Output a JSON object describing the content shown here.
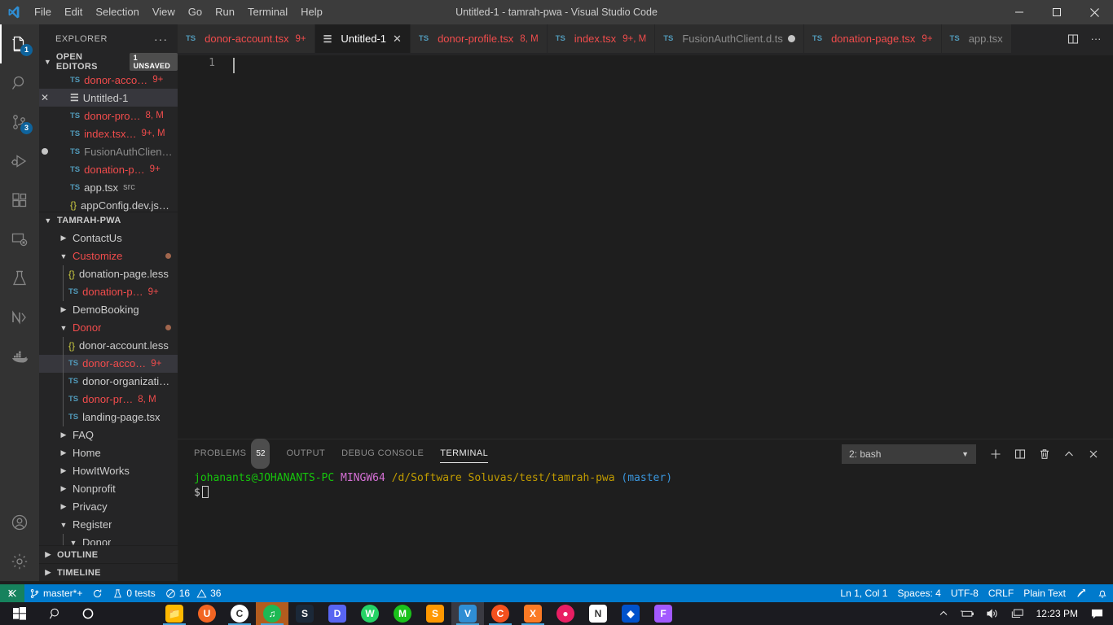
{
  "window": {
    "title": "Untitled-1 - tamrah-pwa - Visual Studio Code",
    "minimize_label": "–",
    "maximize_label": "❐",
    "close_label": "✕"
  },
  "menubar": {
    "items": [
      {
        "label": "File"
      },
      {
        "label": "Edit"
      },
      {
        "label": "Selection"
      },
      {
        "label": "View"
      },
      {
        "label": "Go"
      },
      {
        "label": "Run"
      },
      {
        "label": "Terminal"
      },
      {
        "label": "Help"
      }
    ]
  },
  "activitybar": {
    "items": [
      {
        "name": "explorer",
        "icon": "files-icon",
        "badge": "1",
        "active": true
      },
      {
        "name": "search",
        "icon": "search-icon",
        "badge": "",
        "active": false
      },
      {
        "name": "source-control",
        "icon": "source-control-icon",
        "badge": "3",
        "active": false
      },
      {
        "name": "run-debug",
        "icon": "run-and-debug-icon",
        "badge": "",
        "active": false
      },
      {
        "name": "extensions",
        "icon": "extensions-icon",
        "badge": "",
        "active": false
      },
      {
        "name": "remote-explorer",
        "icon": "remote-explorer-icon",
        "badge": "",
        "active": false
      },
      {
        "name": "testing",
        "icon": "beaker-icon",
        "badge": "",
        "active": false
      },
      {
        "name": "nx-console",
        "icon": "nx-icon",
        "badge": "",
        "active": false
      },
      {
        "name": "docker",
        "icon": "docker-icon",
        "badge": "",
        "active": false
      }
    ],
    "bottom": [
      {
        "name": "accounts",
        "icon": "account-icon"
      },
      {
        "name": "settings",
        "icon": "gear-icon"
      }
    ]
  },
  "sidebar": {
    "title": "EXPLORER",
    "more_actions": "···",
    "open_editors": {
      "label": "OPEN EDITORS",
      "badge": "1 UNSAVED",
      "expanded": true,
      "items": [
        {
          "icon": "ts",
          "name": "donor-acco…",
          "suffix": "9+",
          "suffix_class": "c-err",
          "name_class": "c-err",
          "selected": false,
          "dirty": false,
          "showClose": false
        },
        {
          "icon": "untitled",
          "name": "Untitled-1",
          "suffix": "",
          "suffix_class": "",
          "name_class": "c-plain",
          "selected": true,
          "dirty": false,
          "showClose": true
        },
        {
          "icon": "ts",
          "name": "donor-pro…",
          "suffix": "8, M",
          "suffix_class": "c-err",
          "name_class": "c-err",
          "selected": false,
          "dirty": false,
          "showClose": false
        },
        {
          "icon": "ts",
          "name": "index.tsx…",
          "suffix": "9+, M",
          "suffix_class": "c-err",
          "name_class": "c-err",
          "selected": false,
          "dirty": false,
          "showClose": false
        },
        {
          "icon": "ts",
          "name": "FusionAuthClient….",
          "suffix": "",
          "suffix_class": "",
          "name_class": "c-dim",
          "selected": false,
          "dirty": true,
          "showClose": false
        },
        {
          "icon": "ts",
          "name": "donation-p…",
          "suffix": "9+",
          "suffix_class": "c-err",
          "name_class": "c-err",
          "selected": false,
          "dirty": false,
          "showClose": false
        },
        {
          "icon": "ts",
          "name": "app.tsx",
          "suffix": "src",
          "suffix_class": "c-sub",
          "name_class": "c-plain",
          "selected": false,
          "dirty": false,
          "showClose": false
        },
        {
          "icon": "json",
          "name": "appConfig.dev.jso…",
          "suffix": "",
          "suffix_class": "",
          "name_class": "c-plain",
          "selected": false,
          "dirty": false,
          "showClose": false
        }
      ]
    },
    "workspace": {
      "label": "TAMRAH-PWA",
      "expanded": true,
      "items": [
        {
          "kind": "folder",
          "twisty": "›",
          "name": "ContactUs",
          "indent": 24,
          "name_class": "c-plain",
          "suffix": "",
          "suffix_class": "",
          "selected": false,
          "mod": false
        },
        {
          "kind": "folder",
          "twisty": "⌄",
          "name": "Customize",
          "indent": 24,
          "name_class": "c-err",
          "suffix": "",
          "suffix_class": "",
          "selected": false,
          "mod": true
        },
        {
          "kind": "json",
          "twisty": "",
          "name": "donation-page.less",
          "indent": 36,
          "name_class": "c-plain",
          "suffix": "",
          "suffix_class": "",
          "selected": false,
          "mod": false
        },
        {
          "kind": "ts",
          "twisty": "",
          "name": "donation-p…",
          "indent": 36,
          "name_class": "c-err",
          "suffix": "9+",
          "suffix_class": "c-err",
          "selected": false,
          "mod": false
        },
        {
          "kind": "folder",
          "twisty": "›",
          "name": "DemoBooking",
          "indent": 24,
          "name_class": "c-plain",
          "suffix": "",
          "suffix_class": "",
          "selected": false,
          "mod": false
        },
        {
          "kind": "folder",
          "twisty": "⌄",
          "name": "Donor",
          "indent": 24,
          "name_class": "c-err",
          "suffix": "",
          "suffix_class": "",
          "selected": false,
          "mod": true
        },
        {
          "kind": "json",
          "twisty": "",
          "name": "donor-account.less",
          "indent": 36,
          "name_class": "c-plain",
          "suffix": "",
          "suffix_class": "",
          "selected": false,
          "mod": false
        },
        {
          "kind": "ts",
          "twisty": "",
          "name": "donor-acco…",
          "indent": 36,
          "name_class": "c-err",
          "suffix": "9+",
          "suffix_class": "c-err",
          "selected": true,
          "mod": false
        },
        {
          "kind": "ts",
          "twisty": "",
          "name": "donor-organizati…",
          "indent": 36,
          "name_class": "c-plain",
          "suffix": "",
          "suffix_class": "",
          "selected": false,
          "mod": false
        },
        {
          "kind": "ts",
          "twisty": "",
          "name": "donor-pr…",
          "indent": 36,
          "name_class": "c-err",
          "suffix": "8, M",
          "suffix_class": "c-err",
          "selected": false,
          "mod": false
        },
        {
          "kind": "ts",
          "twisty": "",
          "name": "landing-page.tsx",
          "indent": 36,
          "name_class": "c-plain",
          "suffix": "",
          "suffix_class": "",
          "selected": false,
          "mod": false
        },
        {
          "kind": "folder",
          "twisty": "›",
          "name": "FAQ",
          "indent": 24,
          "name_class": "c-plain",
          "suffix": "",
          "suffix_class": "",
          "selected": false,
          "mod": false
        },
        {
          "kind": "folder",
          "twisty": "›",
          "name": "Home",
          "indent": 24,
          "name_class": "c-plain",
          "suffix": "",
          "suffix_class": "",
          "selected": false,
          "mod": false
        },
        {
          "kind": "folder",
          "twisty": "›",
          "name": "HowItWorks",
          "indent": 24,
          "name_class": "c-plain",
          "suffix": "",
          "suffix_class": "",
          "selected": false,
          "mod": false
        },
        {
          "kind": "folder",
          "twisty": "›",
          "name": "Nonprofit",
          "indent": 24,
          "name_class": "c-plain",
          "suffix": "",
          "suffix_class": "",
          "selected": false,
          "mod": false
        },
        {
          "kind": "folder",
          "twisty": "›",
          "name": "Privacy",
          "indent": 24,
          "name_class": "c-plain",
          "suffix": "",
          "suffix_class": "",
          "selected": false,
          "mod": false
        },
        {
          "kind": "folder",
          "twisty": "⌄",
          "name": "Register",
          "indent": 24,
          "name_class": "c-plain",
          "suffix": "",
          "suffix_class": "",
          "selected": false,
          "mod": false
        },
        {
          "kind": "folder",
          "twisty": "⌄",
          "name": "Donor",
          "indent": 36,
          "name_class": "c-plain",
          "suffix": "",
          "suffix_class": "",
          "selected": false,
          "mod": false
        }
      ]
    },
    "outline": {
      "label": "OUTLINE",
      "expanded": false
    },
    "timeline": {
      "label": "TIMELINE",
      "expanded": false
    }
  },
  "tabs": [
    {
      "icon": "ts",
      "label": "donor-account.tsx",
      "suffix": "9+",
      "active": false,
      "dirty": false,
      "close": false,
      "label_class": "c-err"
    },
    {
      "icon": "untitled",
      "label": "Untitled-1",
      "suffix": "",
      "active": true,
      "dirty": false,
      "close": true,
      "label_class": "c-plain"
    },
    {
      "icon": "ts",
      "label": "donor-profile.tsx",
      "suffix": "8, M",
      "active": false,
      "dirty": false,
      "close": false,
      "label_class": "c-err"
    },
    {
      "icon": "ts",
      "label": "index.tsx",
      "suffix": "9+, M",
      "active": false,
      "dirty": false,
      "close": false,
      "label_class": "c-err"
    },
    {
      "icon": "ts",
      "label": "FusionAuthClient.d.ts",
      "suffix": "",
      "active": false,
      "dirty": true,
      "close": false,
      "label_class": "c-dim"
    },
    {
      "icon": "ts",
      "label": "donation-page.tsx",
      "suffix": "9+",
      "active": false,
      "dirty": false,
      "close": false,
      "label_class": "c-err"
    },
    {
      "icon": "ts",
      "label": "app.tsx",
      "suffix": "",
      "active": false,
      "dirty": false,
      "close": false,
      "label_class": "c-dim"
    }
  ],
  "tab_actions": {
    "split_editor": "split-editor-icon",
    "more": "···"
  },
  "editor": {
    "line_numbers": [
      "1"
    ],
    "content": ""
  },
  "panel": {
    "tabs": [
      {
        "label": "PROBLEMS",
        "count": "52",
        "active": false
      },
      {
        "label": "OUTPUT",
        "count": "",
        "active": false
      },
      {
        "label": "DEBUG CONSOLE",
        "count": "",
        "active": false
      },
      {
        "label": "TERMINAL",
        "count": "",
        "active": true
      }
    ],
    "terminal_select": "2: bash",
    "actions": [
      {
        "name": "new-terminal-button",
        "glyph": "+"
      },
      {
        "name": "split-terminal-button",
        "glyph": "split"
      },
      {
        "name": "kill-terminal-button",
        "glyph": "trash"
      },
      {
        "name": "maximize-panel-button",
        "glyph": "^"
      },
      {
        "name": "close-panel-button",
        "glyph": "✕"
      }
    ],
    "terminal": {
      "user_host": "johanants@JOHANANTS-PC",
      "shell": "MINGW64",
      "path": "/d/Software Soluvas/test/tamrah-pwa",
      "branch": "(master)",
      "prompt": "$"
    }
  },
  "statusbar": {
    "left": [
      {
        "name": "remote-indicator",
        "icon": "remote-icon",
        "label": ""
      },
      {
        "name": "branch-status",
        "icon": "source-control-icon",
        "label": "master*+"
      },
      {
        "name": "sync-status",
        "icon": "sync-icon",
        "label": ""
      },
      {
        "name": "test-status",
        "icon": "beaker-icon",
        "label": "0 tests"
      },
      {
        "name": "problems-status",
        "icon": "error-warning-icon",
        "label": "16",
        "label2": "36"
      }
    ],
    "right": [
      {
        "name": "cursor-position",
        "label": "Ln 1, Col 1"
      },
      {
        "name": "indentation",
        "label": "Spaces: 4"
      },
      {
        "name": "encoding",
        "label": "UTF-8"
      },
      {
        "name": "eol",
        "label": "CRLF"
      },
      {
        "name": "language-mode",
        "label": "Plain Text"
      },
      {
        "name": "feedback-button",
        "label": ""
      },
      {
        "name": "notifications-button",
        "label": ""
      }
    ]
  },
  "taskbar": {
    "start": "windows-start-icon",
    "search": "search-icon",
    "cortana": "cortana-icon",
    "apps": [
      {
        "name": "file-explorer",
        "glyph": "📁",
        "color": "#ffb900",
        "running": true,
        "hl": ""
      },
      {
        "name": "uc-browser",
        "glyph": "U",
        "color": "#f26522",
        "running": false,
        "hl": ""
      },
      {
        "name": "google-chrome",
        "glyph": "C",
        "color": "#ffffff",
        "running": true,
        "hl": ""
      },
      {
        "name": "spotify",
        "glyph": "♫",
        "color": "#1db954",
        "running": true,
        "hl": "hl"
      },
      {
        "name": "steam",
        "glyph": "S",
        "color": "#1b2838",
        "running": false,
        "hl": ""
      },
      {
        "name": "discord",
        "glyph": "D",
        "color": "#5865f2",
        "running": false,
        "hl": ""
      },
      {
        "name": "whatsapp",
        "glyph": "W",
        "color": "#25d366",
        "running": false,
        "hl": ""
      },
      {
        "name": "messages",
        "glyph": "M",
        "color": "#1bc21b",
        "running": false,
        "hl": ""
      },
      {
        "name": "sublime-text",
        "glyph": "S",
        "color": "#ff9800",
        "running": false,
        "hl": ""
      },
      {
        "name": "visual-studio-code",
        "glyph": "V",
        "color": "#2f8ed4",
        "running": true,
        "hl": "hl2"
      },
      {
        "name": "clockify",
        "glyph": "C",
        "color": "#f4511e",
        "running": true,
        "hl": ""
      },
      {
        "name": "xampp",
        "glyph": "X",
        "color": "#fb7a24",
        "running": true,
        "hl": ""
      },
      {
        "name": "chat-app",
        "glyph": "●",
        "color": "#e91e63",
        "running": false,
        "hl": ""
      },
      {
        "name": "notion",
        "glyph": "N",
        "color": "#ffffff",
        "running": false,
        "hl": ""
      },
      {
        "name": "sourcetree",
        "glyph": "◆",
        "color": "#0052cc",
        "running": false,
        "hl": ""
      },
      {
        "name": "figma",
        "glyph": "F",
        "color": "#a259ff",
        "running": false,
        "hl": ""
      }
    ],
    "tray": {
      "chevron": "show-hidden-icons",
      "network": "network-icon",
      "volume": "volume-icon",
      "display": "display-icon",
      "clock": "12:23 PM",
      "action_center": "action-center-icon"
    }
  }
}
